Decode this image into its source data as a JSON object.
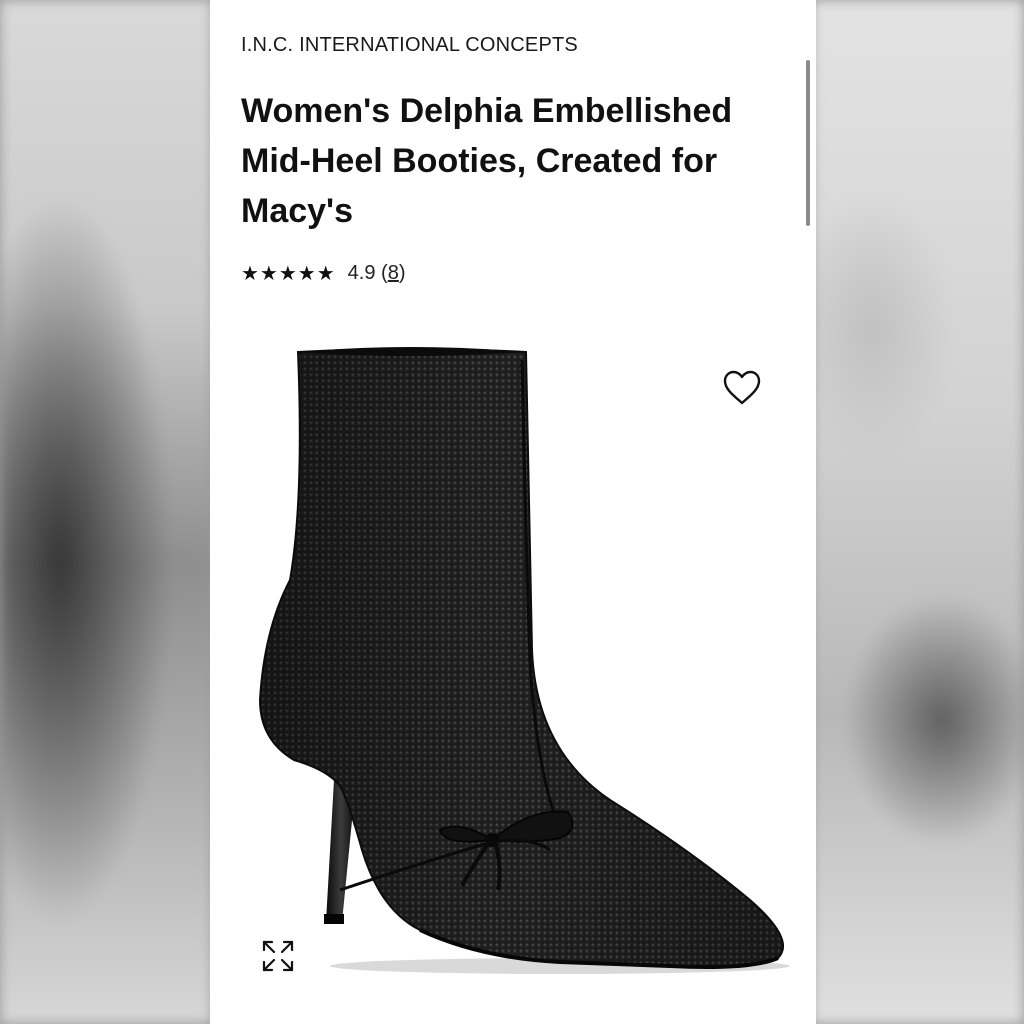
{
  "product": {
    "brand": "I.N.C. INTERNATIONAL CONCEPTS",
    "title": "Women's Delphia Embellished Mid-Heel Booties, Created for Macy's",
    "rating": {
      "stars": "★★★★★",
      "score": "4.9",
      "open_paren": "(",
      "review_count": "8",
      "close_paren": ")"
    }
  },
  "icons": {
    "wishlist": "heart-outline-icon",
    "expand": "expand-arrows-icon"
  },
  "colors": {
    "text": "#111111",
    "boot": "#1b1b1b",
    "background": "#ffffff"
  }
}
